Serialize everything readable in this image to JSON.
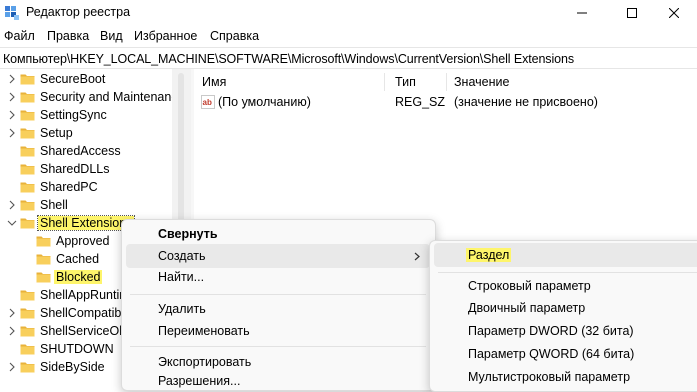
{
  "window": {
    "title": "Редактор реестра",
    "icons": {
      "app": "registry-editor-icon",
      "minimize": "minimize-icon",
      "maximize": "maximize-icon",
      "close": "close-icon"
    }
  },
  "menu": [
    "Файл",
    "Правка",
    "Вид",
    "Избранное",
    "Справка"
  ],
  "address": "Компьютер\\HKEY_LOCAL_MACHINE\\SOFTWARE\\Microsoft\\Windows\\CurrentVersion\\Shell Extensions",
  "tree": [
    {
      "label": "SecureBoot",
      "level": 0,
      "expander": "collapsed"
    },
    {
      "label": "Security and Maintenanc",
      "level": 0,
      "expander": "collapsed"
    },
    {
      "label": "SettingSync",
      "level": 0,
      "expander": "collapsed"
    },
    {
      "label": "Setup",
      "level": 0,
      "expander": "collapsed"
    },
    {
      "label": "SharedAccess",
      "level": 0,
      "expander": "none"
    },
    {
      "label": "SharedDLLs",
      "level": 0,
      "expander": "none"
    },
    {
      "label": "SharedPC",
      "level": 0,
      "expander": "none"
    },
    {
      "label": "Shell",
      "level": 0,
      "expander": "collapsed"
    },
    {
      "label": "Shell Extensions",
      "level": 0,
      "expander": "expanded",
      "state": "selected"
    },
    {
      "label": "Approved",
      "level": 1,
      "expander": "none"
    },
    {
      "label": "Cached",
      "level": 1,
      "expander": "none"
    },
    {
      "label": "Blocked",
      "level": 1,
      "expander": "none",
      "state": "highlighted"
    },
    {
      "label": "ShellAppRuntim",
      "level": 0,
      "expander": "none"
    },
    {
      "label": "ShellCompatibi",
      "level": 0,
      "expander": "collapsed"
    },
    {
      "label": "ShellServiceObj",
      "level": 0,
      "expander": "collapsed"
    },
    {
      "label": "SHUTDOWN",
      "level": 0,
      "expander": "none"
    },
    {
      "label": "SideBySide",
      "level": 0,
      "expander": "collapsed"
    }
  ],
  "list": {
    "columns": {
      "name": "Имя",
      "type": "Тип",
      "value": "Значение"
    },
    "rows": [
      {
        "name": "(По умолчанию)",
        "type": "REG_SZ",
        "value": "(значение не присвоено)",
        "icon": "string-value-icon"
      }
    ]
  },
  "context_menu": {
    "items": [
      "Свернуть",
      "Создать",
      "Найти...",
      "Удалить",
      "Переименовать",
      "Экспортировать",
      "Разрешения..."
    ],
    "bold_item": "Свернуть",
    "hovered_item": "Создать"
  },
  "submenu": {
    "items": [
      "Раздел",
      "Строковый параметр",
      "Двоичный параметр",
      "Параметр DWORD (32 бита)",
      "Параметр QWORD (64 бита)",
      "Мультистроковый параметр"
    ],
    "highlighted_item": "Раздел"
  },
  "colors": {
    "highlight": "#fef56b",
    "folder": "#f8cf5c",
    "folder_dark": "#e8b23a"
  }
}
